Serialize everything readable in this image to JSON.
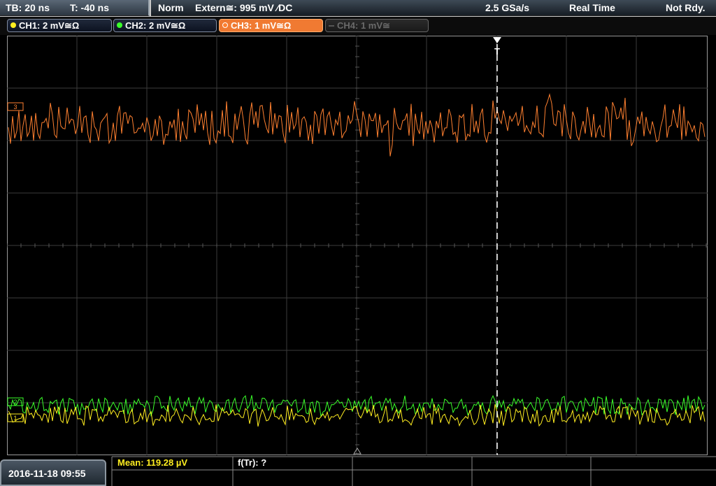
{
  "header": {
    "timebase": "TB: 20 ns",
    "trigger_time": "T: -40 ns",
    "mode": "Norm",
    "trigger_source": "Extern≅: 995 mV ∕DC",
    "sample_rate": "2.5 GSa/s",
    "acq_mode": "Real Time",
    "status": "Not Rdy."
  },
  "channels": [
    {
      "label": "CH1: 2 mV≅Ω",
      "color": "#ffee20",
      "state": "on"
    },
    {
      "label": "CH2: 2 mV≅Ω",
      "color": "#3aff2a",
      "state": "on"
    },
    {
      "label": "CH3: 1 mV≅Ω",
      "color": "#ff8030",
      "state": "active"
    },
    {
      "label": "CH4: 1 mV≅",
      "color": "#707070",
      "state": "off"
    }
  ],
  "markers": {
    "trigger_label": "T",
    "ch3_ref": "3",
    "ch2_ref": "2",
    "ch1_ref": "1"
  },
  "measurement": {
    "mean": "Mean: 119.28 µV",
    "freq": "f(Tr): ?"
  },
  "footer": {
    "date": "2016-11-18 09:55"
  },
  "colors": {
    "ch1": "#ffee20",
    "ch2": "#3aff2a",
    "ch3": "#ff8030",
    "grid": "#3c3c3c",
    "accent": "#f07a32"
  }
}
